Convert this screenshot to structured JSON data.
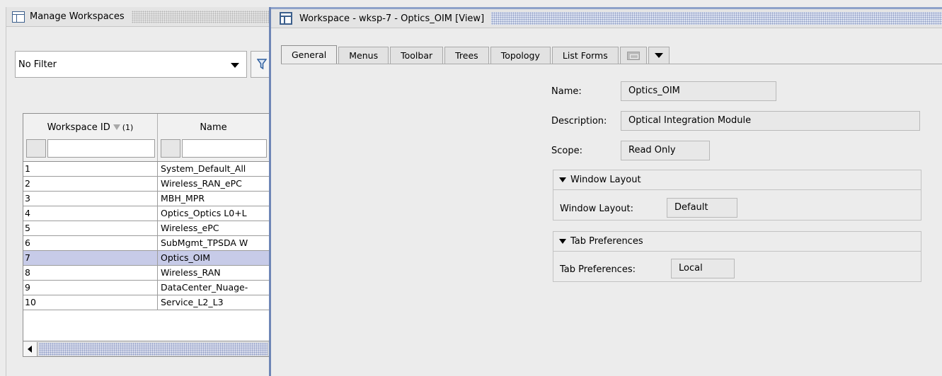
{
  "left_panel": {
    "title": "Manage Workspaces",
    "filter": {
      "value": "No Filter"
    },
    "table": {
      "columns": [
        "Workspace ID",
        "Name"
      ],
      "sort_rank": "(1)",
      "rows": [
        {
          "id": "1",
          "name": "System_Default_All"
        },
        {
          "id": "2",
          "name": "Wireless_RAN_ePC"
        },
        {
          "id": "3",
          "name": "MBH_MPR"
        },
        {
          "id": "4",
          "name": "Optics_Optics L0+L"
        },
        {
          "id": "5",
          "name": "Wireless_ePC"
        },
        {
          "id": "6",
          "name": "SubMgmt_TPSDA W"
        },
        {
          "id": "7",
          "name": "Optics_OIM",
          "selected": true
        },
        {
          "id": "8",
          "name": "Wireless_RAN"
        },
        {
          "id": "9",
          "name": "DataCenter_Nuage-"
        },
        {
          "id": "10",
          "name": "Service_L2_L3"
        }
      ]
    }
  },
  "window": {
    "title": "Workspace - wksp-7 - Optics_OIM [View]",
    "tabs": [
      {
        "label": "General",
        "active": true
      },
      {
        "label": "Menus"
      },
      {
        "label": "Toolbar"
      },
      {
        "label": "Trees"
      },
      {
        "label": "Topology"
      },
      {
        "label": "List Forms"
      }
    ],
    "form": {
      "name_label": "Name:",
      "name_value": "Optics_OIM",
      "description_label": "Description:",
      "description_value": "Optical Integration Module",
      "scope_label": "Scope:",
      "scope_value": "Read Only"
    },
    "window_layout_section": {
      "title": "Window Layout",
      "label": "Window Layout:",
      "value": "Default"
    },
    "tab_preferences_section": {
      "title": "Tab Preferences",
      "label": "Tab Preferences:",
      "value": "Local"
    }
  }
}
